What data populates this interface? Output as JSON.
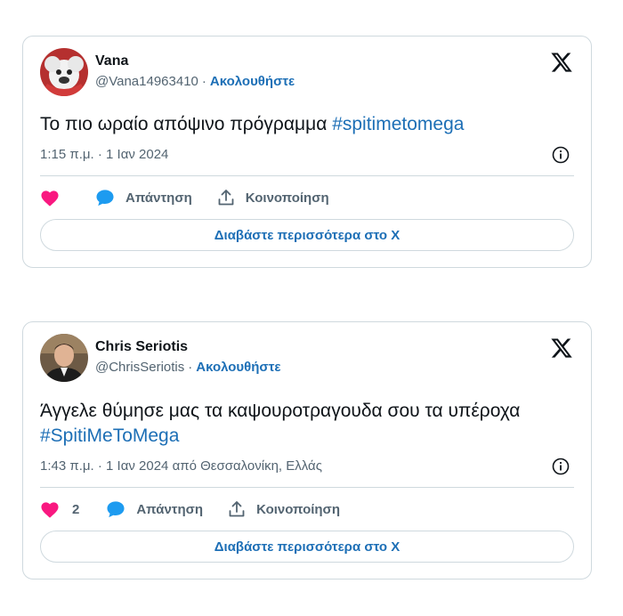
{
  "colors": {
    "link": "#1d6fb6",
    "like": "#f91880",
    "reply": "#1d9bf0",
    "muted": "#536471",
    "border": "#cfd9de"
  },
  "tweets": [
    {
      "author": "Vana",
      "handle": "@Vana14963410",
      "separator": "·",
      "follow_label": "Ακολουθήστε",
      "text": "Το πιο ωραίο απόψινο πρόγραμμα ",
      "hashtag": "#spitimetomega",
      "timestamp": "1:15 π.μ. · 1 Ιαν 2024",
      "like_icon": "heart-icon",
      "reply_label": "Απάντηση",
      "share_label": "Κοινοποίηση",
      "read_more": "Διαβάστε περισσότερα στο X"
    },
    {
      "author": "Chris Seriotis",
      "handle": "@ChrisSeriotis",
      "separator": "·",
      "follow_label": "Ακολουθήστε",
      "text": "Άγγελε θύμησε μας τα καψουροτραγουδα σου τα υπέροχα ",
      "hashtag": "#SpitiMeToMega",
      "timestamp": "1:43 π.μ. · 1 Ιαν 2024 από Θεσσαλονίκη, Ελλάς",
      "like_count": "2",
      "reply_label": "Απάντηση",
      "share_label": "Κοινοποίηση",
      "read_more": "Διαβάστε περισσότερα στο X"
    }
  ]
}
